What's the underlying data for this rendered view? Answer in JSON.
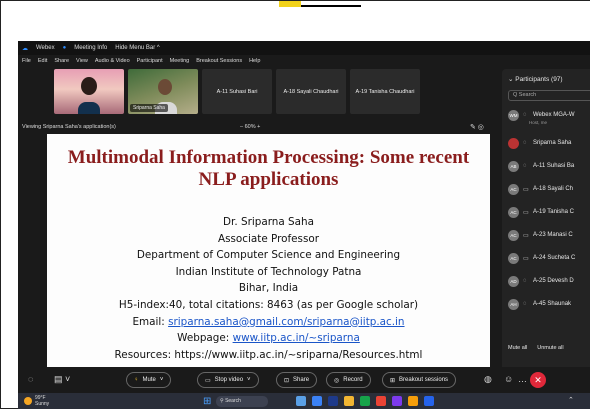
{
  "titlebar": {
    "app": "Webex",
    "meeting_info": "Meeting Info",
    "hide_menu": "Hide Menu Bar ^"
  },
  "menu": [
    "File",
    "Edit",
    "Share",
    "View",
    "Audio & Video",
    "Participant",
    "Meeting",
    "Breakout Sessions",
    "Help"
  ],
  "thumbnails": [
    {
      "name": ""
    },
    {
      "name": "Sriparna Saha"
    },
    {
      "name": "A-11 Suhasi Bari"
    },
    {
      "name": "A-18 Sayali Chaudhari"
    },
    {
      "name": "A-19 Tanisha Chaudhari"
    }
  ],
  "viewing": {
    "label": "Viewing Sriparna Saha's application(s)",
    "zoom": "–  60%  +"
  },
  "slide": {
    "title_line1": "Multimodal Information Processing: Some recent",
    "title_line2": "NLP applications",
    "name": "Dr. Sriparna Saha",
    "position": "Associate Professor",
    "department": "Department of Computer Science and Engineering",
    "institute": "Indian Institute of Technology Patna",
    "location": "Bihar, India",
    "h_index": "H5-index:40, total citations: 8463 (as per Google scholar)",
    "email_label": "Email: ",
    "email_value": "sriparna.saha@gmail.com/sriparna@iitp.ac.in",
    "webpage_label": "Webpage: ",
    "webpage_value": "www.iitp.ac.in/~sriparna",
    "resources": "Resources: https://www.iitp.ac.in/~sriparna/Resources.html"
  },
  "participants": {
    "header": "Participants (97)",
    "search_placeholder": "Q Search",
    "list": [
      {
        "initials": "WM",
        "name": "Webex MGA-W",
        "sub": "Host, me"
      },
      {
        "initials": "SS",
        "name": "Sriparna Saha",
        "sub": ""
      },
      {
        "initials": "AB",
        "name": "A-11 Suhasi Ba",
        "sub": ""
      },
      {
        "initials": "AC",
        "name": "A-18 Sayali Ch",
        "sub": ""
      },
      {
        "initials": "AC",
        "name": "A-19 Tanisha C",
        "sub": ""
      },
      {
        "initials": "AC",
        "name": "A-23 Manasi C",
        "sub": ""
      },
      {
        "initials": "AC",
        "name": "A-24 Sucheta C",
        "sub": ""
      },
      {
        "initials": "AD",
        "name": "A-25 Devesh D",
        "sub": ""
      },
      {
        "initials": "AH",
        "name": "A-45 Shaunak",
        "sub": ""
      }
    ],
    "mute_all": "Mute all",
    "unmute_all": "Unmute all"
  },
  "controls": {
    "mute": "Mute",
    "stop_video": "Stop video",
    "share": "Share",
    "record": "Record",
    "breakout": "Breakout sessions"
  },
  "taskbar": {
    "temp": "99°F",
    "weather": "Sunny",
    "search": "Search"
  },
  "colors": {
    "slide_title": "#8a1d1d",
    "link": "#1a55c8",
    "end_call": "#e0283a",
    "webex_blue": "#2d8cff"
  }
}
